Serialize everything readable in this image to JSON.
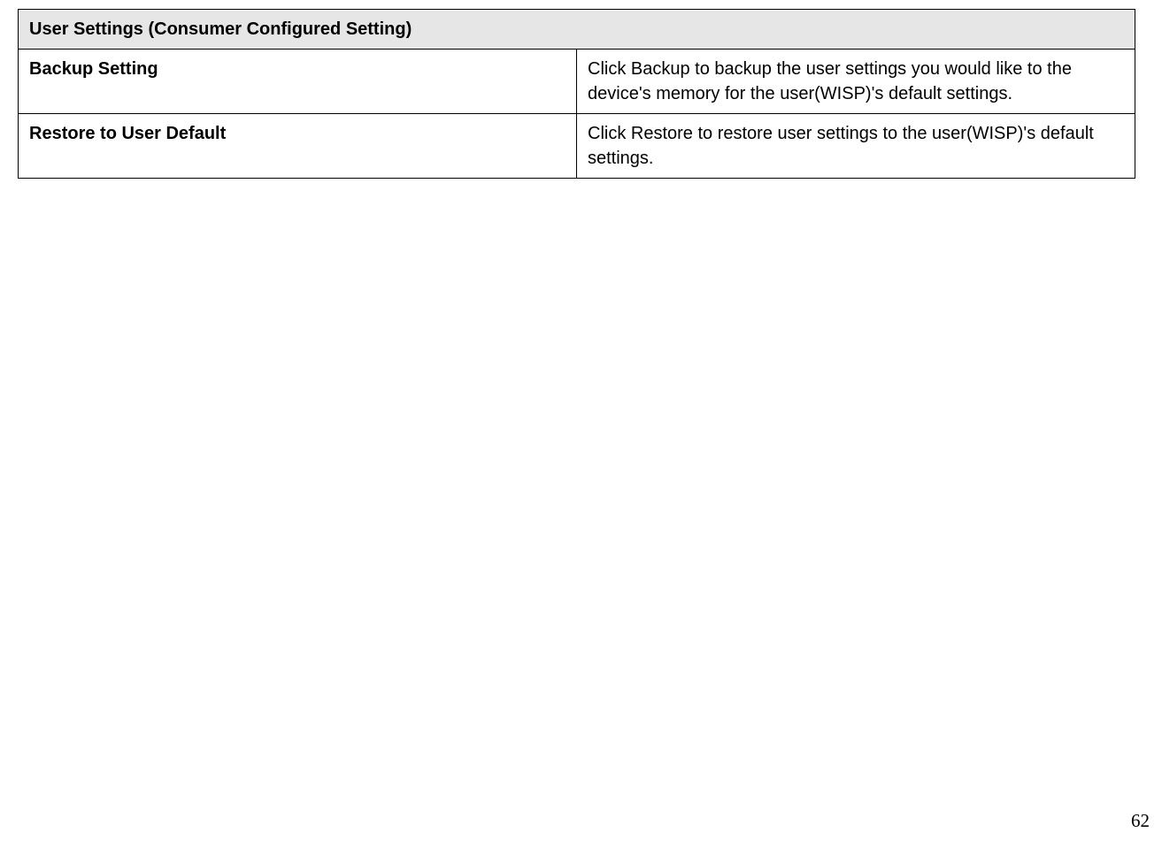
{
  "table": {
    "header": "User Settings (Consumer Configured Setting)",
    "rows": [
      {
        "label": "Backup Setting",
        "description": "Click Backup to backup the user settings you would like to the device's memory for the user(WISP)'s default settings."
      },
      {
        "label": "Restore to User Default",
        "description": "Click Restore to restore user settings to the user(WISP)'s default settings."
      }
    ]
  },
  "page_number": "62"
}
